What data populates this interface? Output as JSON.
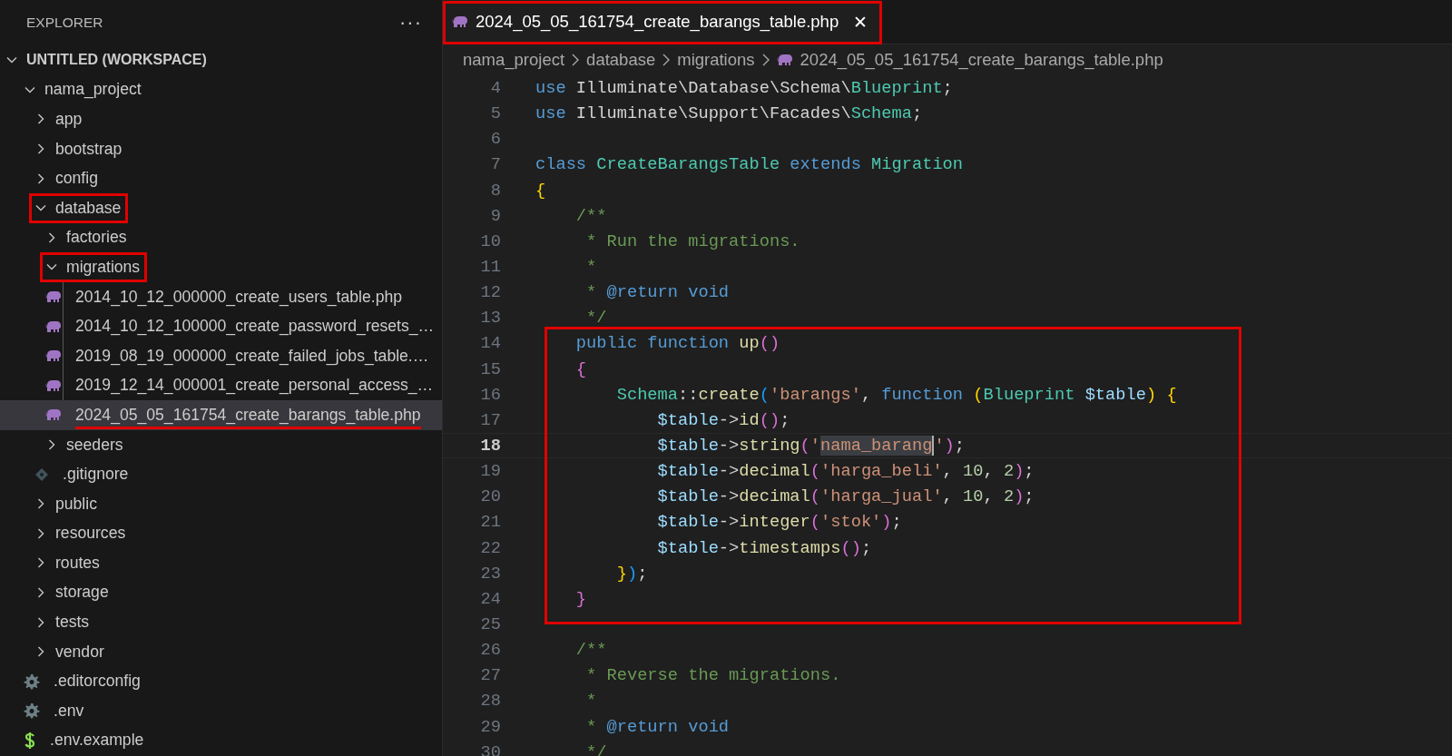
{
  "explorer": {
    "title": "EXPLORER",
    "more": "···"
  },
  "tree": [
    {
      "label": "UNTITLED (WORKSPACE)",
      "kind": "folder",
      "expanded": true,
      "selected": false,
      "boxed": false,
      "underlined": false,
      "children": [
        {
          "label": "nama_project",
          "kind": "folder",
          "expanded": true,
          "selected": false,
          "boxed": false,
          "underlined": false,
          "children": [
            {
              "label": "app",
              "kind": "folder",
              "expanded": false,
              "selected": false,
              "boxed": false,
              "underlined": false
            },
            {
              "label": "bootstrap",
              "kind": "folder",
              "expanded": false,
              "selected": false,
              "boxed": false,
              "underlined": false
            },
            {
              "label": "config",
              "kind": "folder",
              "expanded": false,
              "selected": false,
              "boxed": false,
              "underlined": false
            },
            {
              "label": "database",
              "kind": "folder",
              "expanded": true,
              "selected": false,
              "boxed": true,
              "underlined": false,
              "children": [
                {
                  "label": "factories",
                  "kind": "folder",
                  "expanded": false,
                  "selected": false,
                  "boxed": false,
                  "underlined": false
                },
                {
                  "label": "migrations",
                  "kind": "folder",
                  "expanded": true,
                  "selected": false,
                  "boxed": true,
                  "underlined": false,
                  "children": [
                    {
                      "label": "2014_10_12_000000_create_users_table.php",
                      "kind": "php",
                      "selected": false,
                      "boxed": false,
                      "underlined": false
                    },
                    {
                      "label": "2014_10_12_100000_create_password_resets_…",
                      "kind": "php",
                      "selected": false,
                      "boxed": false,
                      "underlined": false
                    },
                    {
                      "label": "2019_08_19_000000_create_failed_jobs_table.…",
                      "kind": "php",
                      "selected": false,
                      "boxed": false,
                      "underlined": false
                    },
                    {
                      "label": "2019_12_14_000001_create_personal_access_…",
                      "kind": "php",
                      "selected": false,
                      "boxed": false,
                      "underlined": false
                    },
                    {
                      "label": "2024_05_05_161754_create_barangs_table.php",
                      "kind": "php",
                      "selected": true,
                      "boxed": false,
                      "underlined": true
                    }
                  ]
                },
                {
                  "label": "seeders",
                  "kind": "folder",
                  "expanded": false,
                  "selected": false,
                  "boxed": false,
                  "underlined": false
                },
                {
                  "label": ".gitignore",
                  "kind": "git",
                  "selected": false,
                  "boxed": false,
                  "underlined": false
                }
              ]
            },
            {
              "label": "public",
              "kind": "folder",
              "expanded": false,
              "selected": false,
              "boxed": false,
              "underlined": false
            },
            {
              "label": "resources",
              "kind": "folder",
              "expanded": false,
              "selected": false,
              "boxed": false,
              "underlined": false
            },
            {
              "label": "routes",
              "kind": "folder",
              "expanded": false,
              "selected": false,
              "boxed": false,
              "underlined": false
            },
            {
              "label": "storage",
              "kind": "folder",
              "expanded": false,
              "selected": false,
              "boxed": false,
              "underlined": false
            },
            {
              "label": "tests",
              "kind": "folder",
              "expanded": false,
              "selected": false,
              "boxed": false,
              "underlined": false
            },
            {
              "label": "vendor",
              "kind": "folder",
              "expanded": false,
              "selected": false,
              "boxed": false,
              "underlined": false
            },
            {
              "label": ".editorconfig",
              "kind": "settings",
              "selected": false,
              "boxed": false,
              "underlined": false
            },
            {
              "label": ".env",
              "kind": "settings",
              "selected": false,
              "boxed": false,
              "underlined": false
            },
            {
              "label": ".env.example",
              "kind": "shell",
              "selected": false,
              "boxed": false,
              "underlined": false
            }
          ]
        }
      ]
    }
  ],
  "tabs": [
    {
      "label": "2024_05_05_161754_create_barangs_table.php",
      "close": "✕",
      "selected": true,
      "boxed": true
    }
  ],
  "breadcrumbs": [
    "nama_project",
    "database",
    "migrations",
    "2024_05_05_161754_create_barangs_table.php"
  ],
  "code": [
    {
      "number": "4",
      "current": false,
      "boxed": false,
      "tokens": [
        {
          "text": "use",
          "kind": "keyword"
        },
        {
          "text": " Illuminate\\Database\\Schema\\",
          "kind": "plain"
        },
        {
          "text": "Blueprint",
          "kind": "type"
        },
        {
          "text": ";",
          "kind": "plain"
        }
      ]
    },
    {
      "number": "5",
      "current": false,
      "boxed": false,
      "tokens": [
        {
          "text": "use",
          "kind": "keyword"
        },
        {
          "text": " Illuminate\\Support\\Facades\\",
          "kind": "plain"
        },
        {
          "text": "Schema",
          "kind": "type"
        },
        {
          "text": ";",
          "kind": "plain"
        }
      ]
    },
    {
      "number": "6",
      "current": false,
      "boxed": false
    },
    {
      "number": "7",
      "current": false,
      "boxed": false,
      "tokens": [
        {
          "text": "class",
          "kind": "keyword"
        },
        {
          "text": " CreateBarangsTable",
          "kind": "type"
        },
        {
          "text": " extends",
          "kind": "keyword"
        },
        {
          "text": " Migration",
          "kind": "type"
        }
      ]
    },
    {
      "number": "8",
      "current": false,
      "boxed": false,
      "tokens": [
        {
          "text": "{",
          "kind": "bracket1"
        }
      ]
    },
    {
      "number": "9",
      "current": false,
      "boxed": false,
      "tokens": [
        {
          "text": "    /**",
          "kind": "comment"
        }
      ]
    },
    {
      "number": "10",
      "current": false,
      "boxed": false,
      "tokens": [
        {
          "text": "     * Run the migrations.",
          "kind": "comment"
        }
      ]
    },
    {
      "number": "11",
      "current": false,
      "boxed": false,
      "tokens": [
        {
          "text": "     *",
          "kind": "comment"
        }
      ]
    },
    {
      "number": "12",
      "current": false,
      "boxed": false,
      "tokens": [
        {
          "text": "     *",
          "kind": "comment"
        },
        {
          "text": " @return",
          "kind": "doctag"
        },
        {
          "text": " void",
          "kind": "doctag"
        }
      ]
    },
    {
      "number": "13",
      "current": false,
      "boxed": false,
      "tokens": [
        {
          "text": "     */",
          "kind": "comment"
        }
      ]
    },
    {
      "number": "14",
      "current": false,
      "boxed": true,
      "tokens": [
        {
          "text": "    public",
          "kind": "keyword"
        },
        {
          "text": " function",
          "kind": "keyword"
        },
        {
          "text": " up",
          "kind": "function"
        },
        {
          "text": "()",
          "kind": "bracket2"
        }
      ]
    },
    {
      "number": "15",
      "current": false,
      "boxed": true,
      "tokens": [
        {
          "text": "    {",
          "kind": "bracket2"
        }
      ]
    },
    {
      "number": "16",
      "current": false,
      "boxed": true,
      "tokens": [
        {
          "text": "        Schema",
          "kind": "type"
        },
        {
          "text": "::",
          "kind": "plain"
        },
        {
          "text": "create",
          "kind": "function"
        },
        {
          "text": "(",
          "kind": "bracket3"
        },
        {
          "text": "'barangs'",
          "kind": "string"
        },
        {
          "text": ",",
          "kind": "plain"
        },
        {
          "text": " function",
          "kind": "keyword"
        },
        {
          "text": " (",
          "kind": "bracket1"
        },
        {
          "text": "Blueprint",
          "kind": "type"
        },
        {
          "text": " $table",
          "kind": "variable"
        },
        {
          "text": ")",
          "kind": "bracket1"
        },
        {
          "text": " {",
          "kind": "bracket1"
        }
      ]
    },
    {
      "number": "17",
      "current": false,
      "boxed": true,
      "tokens": [
        {
          "text": "            $table",
          "kind": "variable"
        },
        {
          "text": "->",
          "kind": "plain"
        },
        {
          "text": "id",
          "kind": "function"
        },
        {
          "text": "()",
          "kind": "bracket2"
        },
        {
          "text": ";",
          "kind": "plain"
        }
      ]
    },
    {
      "number": "18",
      "current": true,
      "boxed": true,
      "tokens": [
        {
          "text": "            $table",
          "kind": "variable"
        },
        {
          "text": "->",
          "kind": "plain"
        },
        {
          "text": "string",
          "kind": "function"
        },
        {
          "text": "(",
          "kind": "bracket2"
        },
        {
          "text": "'",
          "kind": "string"
        },
        {
          "text": "nama_barang",
          "kind": "selection"
        },
        {
          "text": "'",
          "kind": "string"
        },
        {
          "text": ")",
          "kind": "bracket2"
        },
        {
          "text": ";",
          "kind": "plain"
        }
      ]
    },
    {
      "number": "19",
      "current": false,
      "boxed": true,
      "tokens": [
        {
          "text": "            $table",
          "kind": "variable"
        },
        {
          "text": "->",
          "kind": "plain"
        },
        {
          "text": "decimal",
          "kind": "function"
        },
        {
          "text": "(",
          "kind": "bracket2"
        },
        {
          "text": "'harga_beli'",
          "kind": "string"
        },
        {
          "text": ",",
          "kind": "plain"
        },
        {
          "text": " 10",
          "kind": "number"
        },
        {
          "text": ",",
          "kind": "plain"
        },
        {
          "text": " 2",
          "kind": "number"
        },
        {
          "text": ")",
          "kind": "bracket2"
        },
        {
          "text": ";",
          "kind": "plain"
        }
      ]
    },
    {
      "number": "20",
      "current": false,
      "boxed": true,
      "tokens": [
        {
          "text": "            $table",
          "kind": "variable"
        },
        {
          "text": "->",
          "kind": "plain"
        },
        {
          "text": "decimal",
          "kind": "function"
        },
        {
          "text": "(",
          "kind": "bracket2"
        },
        {
          "text": "'harga_jual'",
          "kind": "string"
        },
        {
          "text": ",",
          "kind": "plain"
        },
        {
          "text": " 10",
          "kind": "number"
        },
        {
          "text": ",",
          "kind": "plain"
        },
        {
          "text": " 2",
          "kind": "number"
        },
        {
          "text": ")",
          "kind": "bracket2"
        },
        {
          "text": ";",
          "kind": "plain"
        }
      ]
    },
    {
      "number": "21",
      "current": false,
      "boxed": true,
      "tokens": [
        {
          "text": "            $table",
          "kind": "variable"
        },
        {
          "text": "->",
          "kind": "plain"
        },
        {
          "text": "integer",
          "kind": "function"
        },
        {
          "text": "(",
          "kind": "bracket2"
        },
        {
          "text": "'stok'",
          "kind": "string"
        },
        {
          "text": ")",
          "kind": "bracket2"
        },
        {
          "text": ";",
          "kind": "plain"
        }
      ]
    },
    {
      "number": "22",
      "current": false,
      "boxed": true,
      "tokens": [
        {
          "text": "            $table",
          "kind": "variable"
        },
        {
          "text": "->",
          "kind": "plain"
        },
        {
          "text": "timestamps",
          "kind": "function"
        },
        {
          "text": "()",
          "kind": "bracket2"
        },
        {
          "text": ";",
          "kind": "plain"
        }
      ]
    },
    {
      "number": "23",
      "current": false,
      "boxed": true,
      "tokens": [
        {
          "text": "        }",
          "kind": "bracket1"
        },
        {
          "text": ")",
          "kind": "bracket3"
        },
        {
          "text": ";",
          "kind": "plain"
        }
      ]
    },
    {
      "number": "24",
      "current": false,
      "boxed": true,
      "tokens": [
        {
          "text": "    }",
          "kind": "bracket2"
        }
      ]
    },
    {
      "number": "25",
      "current": false,
      "boxed": false
    },
    {
      "number": "26",
      "current": false,
      "boxed": false,
      "tokens": [
        {
          "text": "    /**",
          "kind": "comment"
        }
      ]
    },
    {
      "number": "27",
      "current": false,
      "boxed": false,
      "tokens": [
        {
          "text": "     * Reverse the migrations.",
          "kind": "comment"
        }
      ]
    },
    {
      "number": "28",
      "current": false,
      "boxed": false,
      "tokens": [
        {
          "text": "     *",
          "kind": "comment"
        }
      ]
    },
    {
      "number": "29",
      "current": false,
      "boxed": false,
      "tokens": [
        {
          "text": "     *",
          "kind": "comment"
        },
        {
          "text": " @return",
          "kind": "doctag"
        },
        {
          "text": " void",
          "kind": "doctag"
        }
      ]
    },
    {
      "number": "30",
      "current": false,
      "boxed": false,
      "tokens": [
        {
          "text": "     */",
          "kind": "comment"
        }
      ]
    }
  ]
}
